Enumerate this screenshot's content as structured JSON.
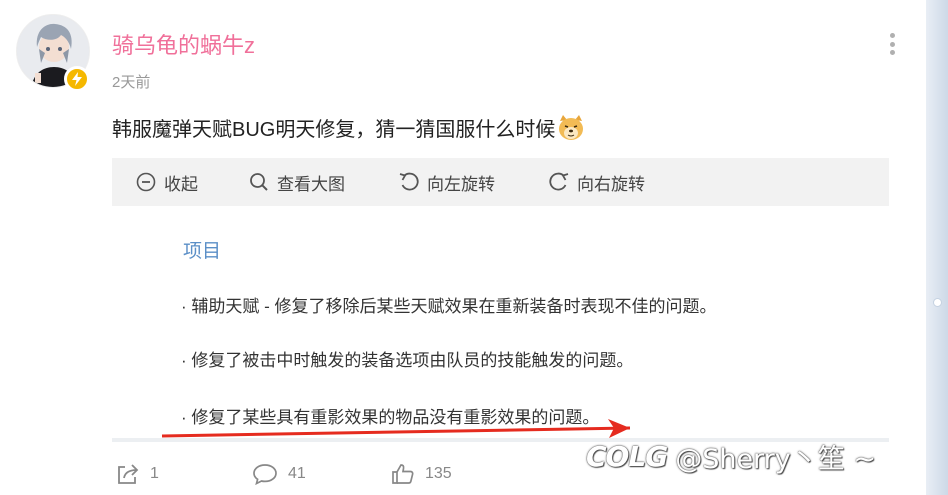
{
  "post": {
    "username": "骑乌龟的蜗牛z",
    "timestamp": "2天前",
    "text": "韩服魔弹天赋BUG明天修复，猜一猜国服什么时候",
    "emoji_icon": "doge-emoji"
  },
  "toolbar": {
    "collapse_label": "收起",
    "zoom_label": "查看大图",
    "rotate_left_label": "向左旋转",
    "rotate_right_label": "向右旋转"
  },
  "image": {
    "title": "项目",
    "lines": [
      "· 辅助天赋 - 修复了移除后某些天赋效果在重新装备时表现不佳的问题。",
      "· 修复了被击中时触发的装备选项由队员的技能触发的问题。",
      "· 修复了某些具有重影效果的物品没有重影效果的问题。"
    ],
    "arrow_color": "#e52b1f"
  },
  "actions": {
    "share_count": "1",
    "comment_count": "41",
    "like_count": "135"
  },
  "watermark": {
    "logo": "COLG",
    "handle": "@Sherry丶笙 ~"
  },
  "colors": {
    "username": "#f0709a",
    "verified_badge": "#f5b800",
    "image_title": "#5b8fc7"
  }
}
